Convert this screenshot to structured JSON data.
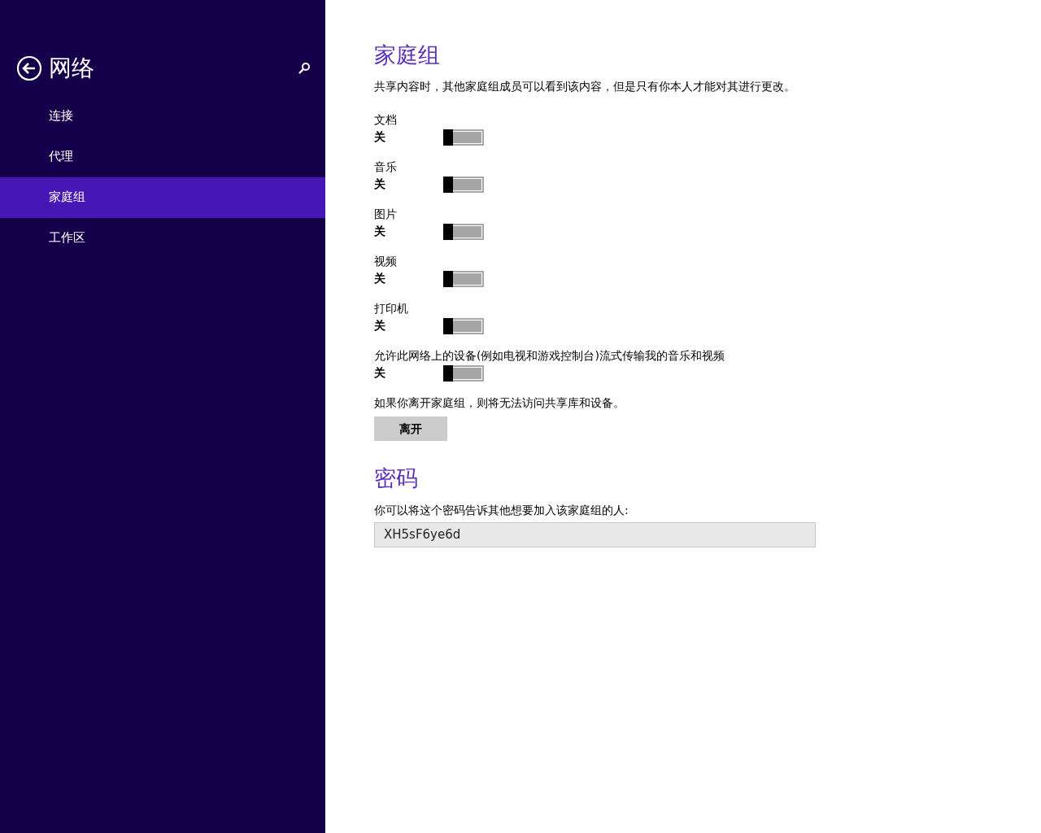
{
  "sidebar": {
    "title": "网络",
    "items": [
      {
        "label": "连接",
        "selected": false
      },
      {
        "label": "代理",
        "selected": false
      },
      {
        "label": "家庭组",
        "selected": true
      },
      {
        "label": "工作区",
        "selected": false
      }
    ]
  },
  "homegroup": {
    "title": "家庭组",
    "description": "共享内容时，其他家庭组成员可以看到该内容，但是只有你本人才能对其进行更改。",
    "toggles": [
      {
        "label": "文档",
        "state_text": "关",
        "on": false
      },
      {
        "label": "音乐",
        "state_text": "关",
        "on": false
      },
      {
        "label": "图片",
        "state_text": "关",
        "on": false
      },
      {
        "label": "视频",
        "state_text": "关",
        "on": false
      },
      {
        "label": "打印机",
        "state_text": "关",
        "on": false
      },
      {
        "label": "允许此网络上的设备(例如电视和游戏控制台)流式传输我的音乐和视频",
        "state_text": "关",
        "on": false
      }
    ],
    "leave_note": "如果你离开家庭组，则将无法访问共享库和设备。",
    "leave_button": "离开"
  },
  "password": {
    "title": "密码",
    "note": "你可以将这个密码告诉其他想要加入该家庭组的人:",
    "value": "XH5sF6ye6d"
  }
}
